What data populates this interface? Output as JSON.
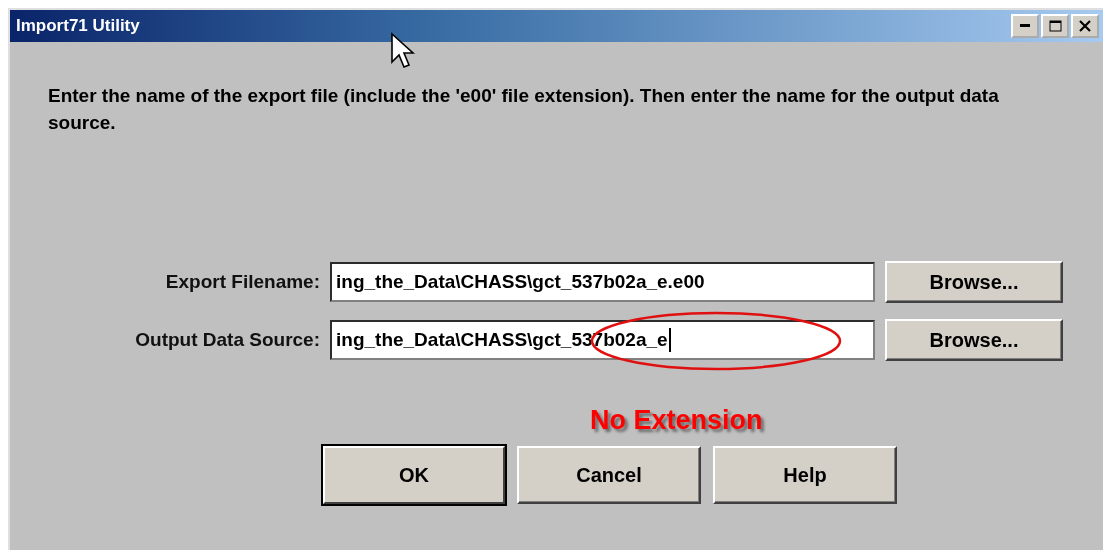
{
  "window": {
    "title": "Import71 Utility"
  },
  "instruction": "Enter the name of the export file (include the 'e00' file extension). Then enter the name for the output data source.",
  "fields": [
    {
      "label": "Export Filename:",
      "value": "ing_the_Data\\CHASS\\gct_537b02a_e.e00",
      "button": "Browse...",
      "focused": false
    },
    {
      "label": "Output Data Source:",
      "value": "ing_the_Data\\CHASS\\gct_537b02a_e",
      "button": "Browse...",
      "focused": true
    }
  ],
  "annotation": "No Extension",
  "buttons": [
    {
      "label": "OK",
      "default": true
    },
    {
      "label": "Cancel",
      "default": false
    },
    {
      "label": "Help",
      "default": false
    }
  ]
}
